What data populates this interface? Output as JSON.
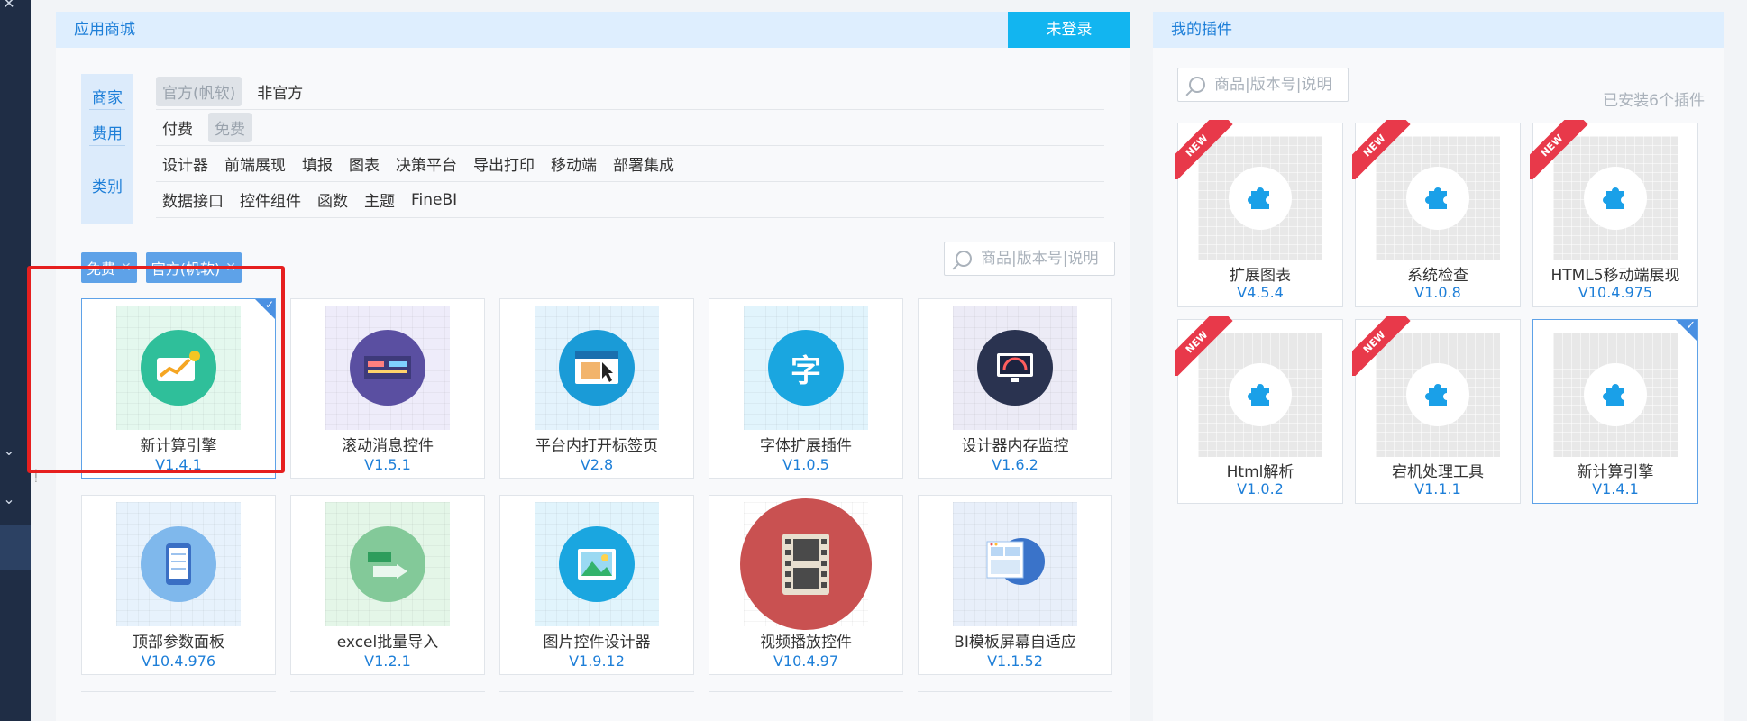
{
  "store": {
    "title": "应用商城",
    "login_label": "未登录",
    "filters": {
      "labels": {
        "merchant": "商家",
        "fee": "费用",
        "category": "类别"
      },
      "merchant_options": [
        "官方(帆软)",
        "非官方"
      ],
      "fee_options": [
        "付费",
        "免费"
      ],
      "category_row1": [
        "设计器",
        "前端展现",
        "填报",
        "图表",
        "决策平台",
        "导出打印",
        "移动端",
        "部署集成"
      ],
      "category_row2": [
        "数据接口",
        "控件组件",
        "函数",
        "主题",
        "FineBI"
      ]
    },
    "chips": [
      "免费",
      "官方(帆软)"
    ],
    "search_placeholder": "商品|版本号|说明",
    "plugins": [
      {
        "name": "新计算引擎",
        "version": "V1.4.1",
        "icon": "chart-growth-icon",
        "color": "#2fbf9a",
        "bg": "#e4f8ee"
      },
      {
        "name": "滚动消息控件",
        "version": "V1.5.1",
        "icon": "scroll-message-icon",
        "color": "#5a4fa1",
        "bg": "#eeecfa"
      },
      {
        "name": "平台内打开标签页",
        "version": "V2.8",
        "icon": "browser-tab-icon",
        "color": "#1a9bd7",
        "bg": "#e4f3fc"
      },
      {
        "name": "字体扩展插件",
        "version": "V1.0.5",
        "icon": "font-icon",
        "color": "#1aa6e0",
        "bg": "#e1f4fc"
      },
      {
        "name": "设计器内存监控",
        "version": "V1.6.2",
        "icon": "monitor-icon",
        "color": "#2a3350",
        "bg": "#ecebf6"
      },
      {
        "name": "顶部参数面板",
        "version": "V10.4.976",
        "icon": "tablet-icon",
        "color": "#7fb8ec",
        "bg": "#e7f2fc"
      },
      {
        "name": "excel批量导入",
        "version": "V1.2.1",
        "icon": "excel-import-icon",
        "color": "#83c999",
        "bg": "#e4f6e8"
      },
      {
        "name": "图片控件设计器",
        "version": "V1.9.12",
        "icon": "image-icon",
        "color": "#1aa6e0",
        "bg": "#e1f4fc"
      },
      {
        "name": "视频播放控件",
        "version": "V10.4.97",
        "icon": "film-icon",
        "color": "#c95151",
        "bg": "#ffffff"
      },
      {
        "name": "BI模板屏幕自适应",
        "version": "V1.1.52",
        "icon": "bi-layout-icon",
        "color": "#4f88d6",
        "bg": "#e8effa"
      }
    ]
  },
  "my_plugins": {
    "title": "我的插件",
    "search_placeholder": "商品|版本号|说明",
    "installed_text": "已安装6个插件",
    "new_badge": "NEW",
    "items": [
      {
        "name": "扩展图表",
        "version": "V4.5.4",
        "new": true
      },
      {
        "name": "系统检查",
        "version": "V1.0.8",
        "new": true
      },
      {
        "name": "HTML5移动端展现",
        "version": "V10.4.975",
        "new": true
      },
      {
        "name": "Html解析",
        "version": "V1.0.2",
        "new": true
      },
      {
        "name": "宕机处理工具",
        "version": "V1.1.1",
        "new": true
      },
      {
        "name": "新计算引擎",
        "version": "V1.4.1",
        "new": false
      }
    ]
  },
  "icons": {
    "rail_top": "wrench-icon",
    "rail_chevron": "chevron-down-icon"
  },
  "colors": {
    "accent": "#1e7fd8",
    "login": "#12b5f0",
    "highlight": "#e61f1f",
    "rail": "#1f2d45"
  }
}
